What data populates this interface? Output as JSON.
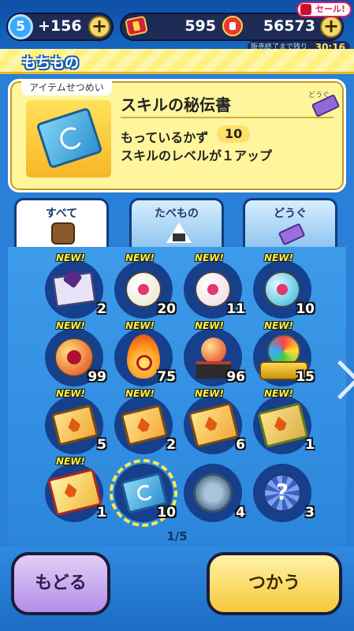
{
  "topbar": {
    "level": "5",
    "stamina": "+156",
    "gems": "595",
    "money": "56573",
    "sale_label": "セール!",
    "timer_label": "販売終了まで残り",
    "timer_value": "30:16"
  },
  "page": {
    "title": "もちもの"
  },
  "description": {
    "header": "アイテムせつめい",
    "category": "どうぐ",
    "item_name": "スキルの秘伝書",
    "count_label": "もっているかず",
    "count": "10",
    "text": "スキルのレベルが１アップ"
  },
  "tabs": [
    {
      "label": "すべて",
      "icon": "bag-icon",
      "active": true
    },
    {
      "label": "たべもの",
      "icon": "onigiri-icon",
      "active": false
    },
    {
      "label": "どうぐ",
      "icon": "ticket-icon",
      "active": false
    }
  ],
  "new_badge": "NEW!",
  "items": [
    {
      "icon": "letter-icon",
      "count": "2",
      "new": true,
      "selected": false
    },
    {
      "icon": "white-orb-icon",
      "count": "20",
      "new": true,
      "selected": false
    },
    {
      "icon": "pearl-orb-icon",
      "count": "11",
      "new": true,
      "selected": false
    },
    {
      "icon": "blue-orb-icon",
      "count": "10",
      "new": true,
      "selected": false
    },
    {
      "icon": "red-orb-icon",
      "count": "99",
      "new": true,
      "selected": false
    },
    {
      "icon": "flame-orb-icon",
      "count": "75",
      "new": true,
      "selected": false
    },
    {
      "icon": "shrine-orb-icon",
      "count": "96",
      "new": true,
      "selected": false
    },
    {
      "icon": "crown-orb-icon",
      "count": "15",
      "new": true,
      "selected": false
    },
    {
      "icon": "book-icon",
      "count": "5",
      "new": true,
      "selected": false
    },
    {
      "icon": "book-icon",
      "count": "2",
      "new": true,
      "selected": false
    },
    {
      "icon": "large-book-icon",
      "count": "6",
      "new": true,
      "selected": false
    },
    {
      "icon": "green-book-icon",
      "count": "1",
      "new": true,
      "selected": false
    },
    {
      "icon": "red-book-icon",
      "count": "1",
      "new": true,
      "selected": false
    },
    {
      "icon": "skill-book-icon",
      "count": "10",
      "new": false,
      "selected": true
    },
    {
      "icon": "medal-icon",
      "count": "4",
      "new": false,
      "selected": false
    },
    {
      "icon": "question-medal-icon",
      "count": "3",
      "new": false,
      "selected": false
    }
  ],
  "pager": "1/5",
  "buttons": {
    "back": "もどる",
    "use": "つかう"
  },
  "colors": {
    "background": "#2a7fd6",
    "panel": "#fff59d",
    "accent": "#f6c83a"
  }
}
